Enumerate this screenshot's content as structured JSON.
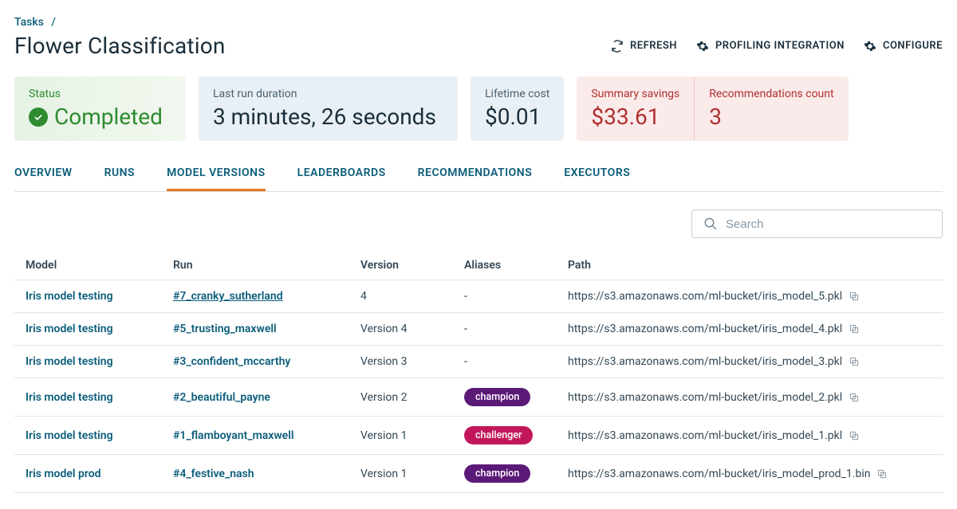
{
  "breadcrumb": {
    "root": "Tasks",
    "sep": "/"
  },
  "page_title": "Flower Classification",
  "header_actions": {
    "refresh": "REFRESH",
    "profiling": "PROFILING INTEGRATION",
    "configure": "CONFIGURE"
  },
  "cards": {
    "status": {
      "label": "Status",
      "value": "Completed"
    },
    "duration": {
      "label": "Last run duration",
      "value": "3 minutes, 26 seconds"
    },
    "cost": {
      "label": "Lifetime cost",
      "value": "$0.01"
    },
    "savings": {
      "label": "Summary savings",
      "value": "$33.61"
    },
    "recs": {
      "label": "Recommendations count",
      "value": "3"
    }
  },
  "tabs": {
    "overview": "OVERVIEW",
    "runs": "RUNS",
    "model_versions": "MODEL VERSIONS",
    "leaderboards": "LEADERBOARDS",
    "recommendations": "RECOMMENDATIONS",
    "executors": "EXECUTORS"
  },
  "search": {
    "placeholder": "Search"
  },
  "table": {
    "headers": {
      "model": "Model",
      "run": "Run",
      "version": "Version",
      "aliases": "Aliases",
      "path": "Path"
    },
    "rows": [
      {
        "model": "Iris model testing",
        "run": "#7_cranky_sutherland",
        "version": "4",
        "alias": "-",
        "alias_type": "",
        "path": "https://s3.amazonaws.com/ml-bucket/iris_model_5.pkl"
      },
      {
        "model": "Iris model testing",
        "run": "#5_trusting_maxwell",
        "version": "Version 4",
        "alias": "-",
        "alias_type": "",
        "path": "https://s3.amazonaws.com/ml-bucket/iris_model_4.pkl"
      },
      {
        "model": "Iris model testing",
        "run": "#3_confident_mccarthy",
        "version": "Version 3",
        "alias": "-",
        "alias_type": "",
        "path": "https://s3.amazonaws.com/ml-bucket/iris_model_3.pkl"
      },
      {
        "model": "Iris model testing",
        "run": "#2_beautiful_payne",
        "version": "Version 2",
        "alias": "champion",
        "alias_type": "champion",
        "path": "https://s3.amazonaws.com/ml-bucket/iris_model_2.pkl"
      },
      {
        "model": "Iris model testing",
        "run": "#1_flamboyant_maxwell",
        "version": "Version 1",
        "alias": "challenger",
        "alias_type": "challenger",
        "path": "https://s3.amazonaws.com/ml-bucket/iris_model_1.pkl"
      },
      {
        "model": "Iris model prod",
        "run": "#4_festive_nash",
        "version": "Version 1",
        "alias": "champion",
        "alias_type": "champion",
        "path": "https://s3.amazonaws.com/ml-bucket/iris_model_prod_1.bin"
      }
    ]
  }
}
